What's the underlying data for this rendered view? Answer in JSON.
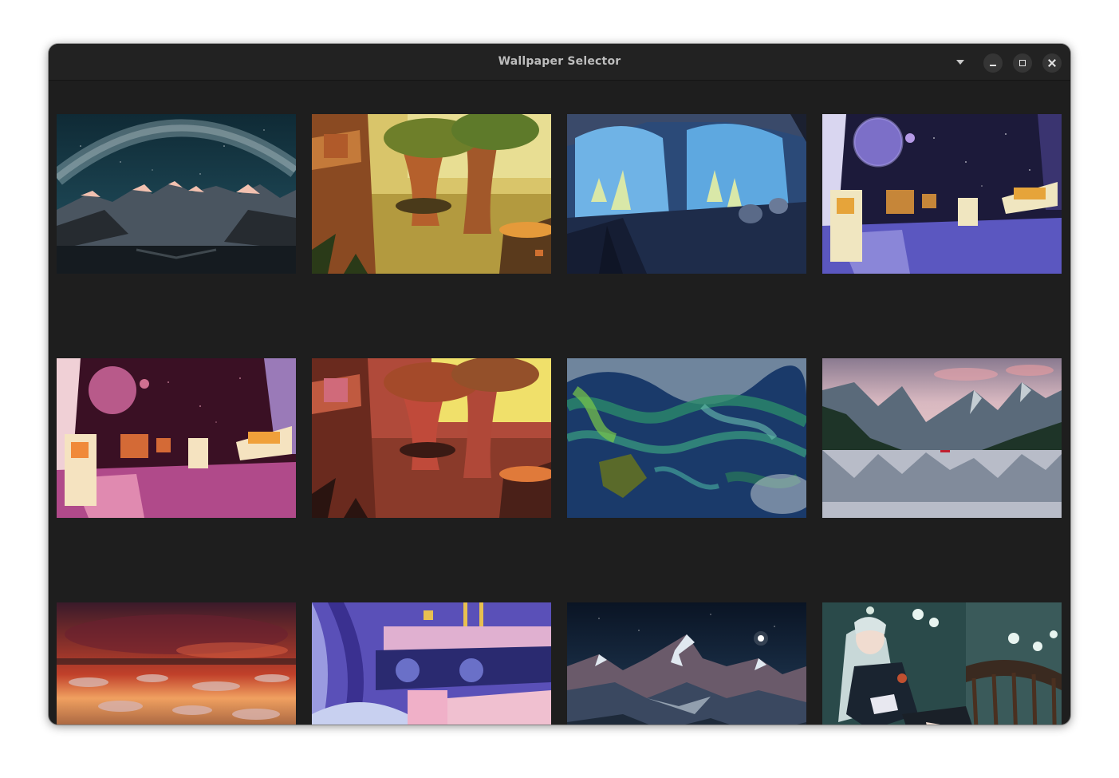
{
  "window": {
    "title": "Wallpaper Selector"
  },
  "controls": {
    "menu_icon": "pan-down-icon",
    "minimize_icon": "minimize-icon",
    "maximize_icon": "maximize-icon",
    "close_icon": "close-icon"
  },
  "wallpapers": [
    {
      "scene": "milky-way-mountains"
    },
    {
      "scene": "cartoon-forest-warm"
    },
    {
      "scene": "cartoon-crystal-cave-blue"
    },
    {
      "scene": "cartoon-space-station-purple"
    },
    {
      "scene": "cartoon-space-station-pink"
    },
    {
      "scene": "cartoon-forest-red"
    },
    {
      "scene": "ocean-plankton-swirls"
    },
    {
      "scene": "lake-mountains-pink-sky"
    },
    {
      "scene": "sunset-ice-lagoon"
    },
    {
      "scene": "cartoon-interior-blue-purple"
    },
    {
      "scene": "night-snowy-mountains"
    },
    {
      "scene": "anime-girl-balcony"
    }
  ]
}
